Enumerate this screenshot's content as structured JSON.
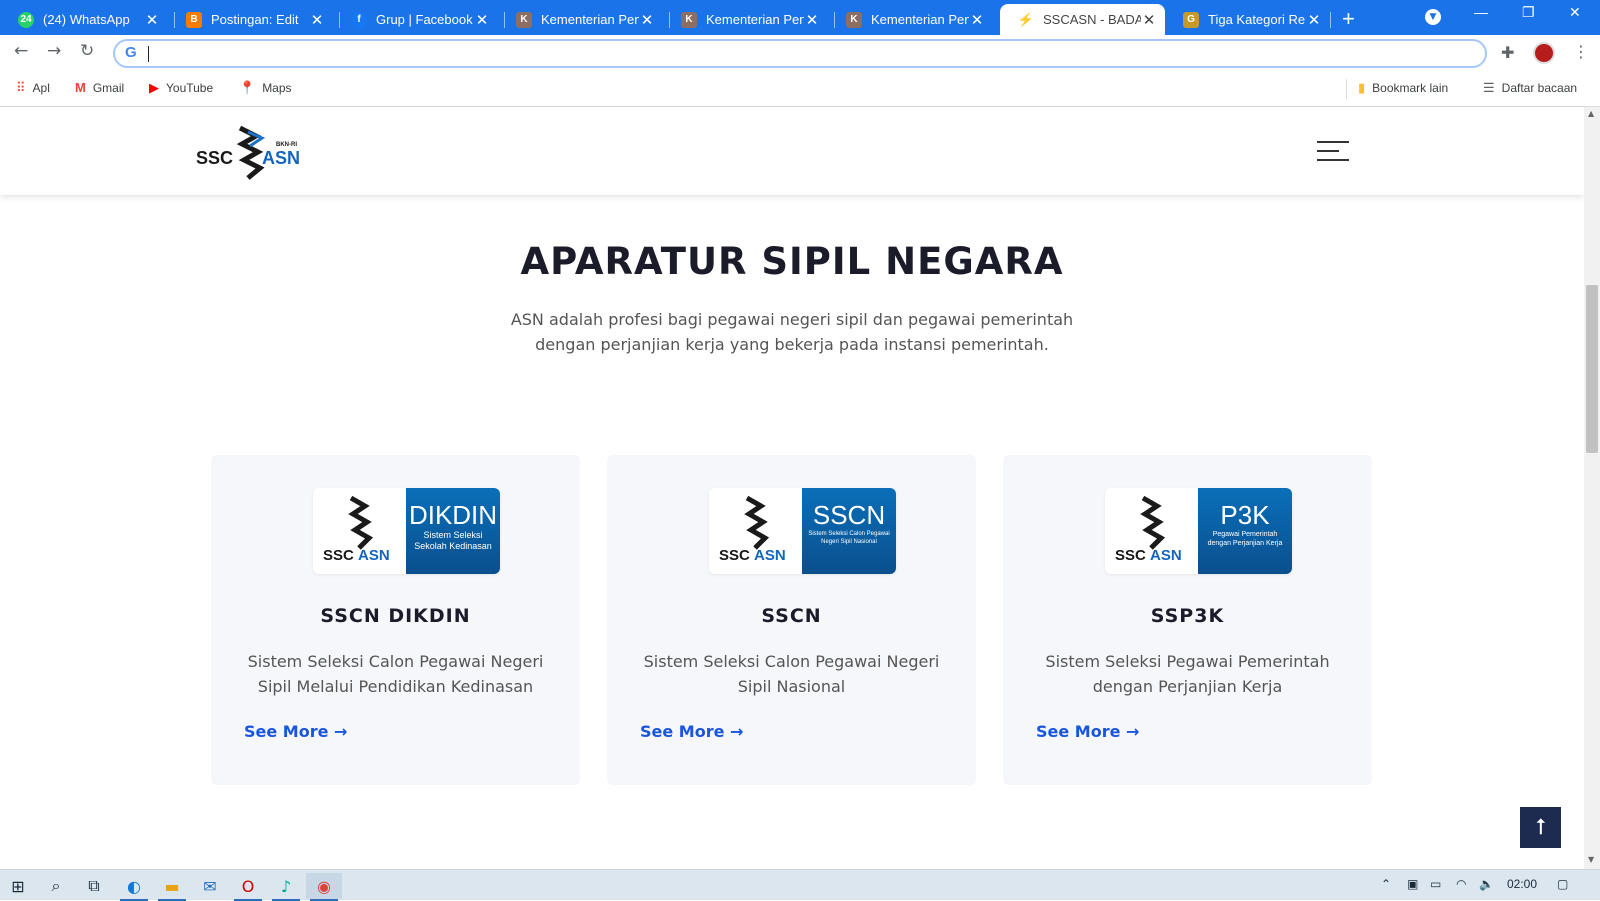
{
  "browser": {
    "tabs": [
      {
        "title": "(24) WhatsApp",
        "favicon_color": "#25d366",
        "favicon_char": "24"
      },
      {
        "title": "Postingan: Edit",
        "favicon_color": "#f57c00",
        "favicon_char": "B"
      },
      {
        "title": "Grup | Facebook",
        "favicon_color": "#1877f2",
        "favicon_char": "f"
      },
      {
        "title": "Kementerian Pend",
        "favicon_color": "#8d6e63",
        "favicon_char": "K"
      },
      {
        "title": "Kementerian Pend",
        "favicon_color": "#8d6e63",
        "favicon_char": "K"
      },
      {
        "title": "Kementerian Pend",
        "favicon_color": "#8d6e63",
        "favicon_char": "K"
      },
      {
        "title": "SSCASN - BADAN",
        "favicon_color": "#222222",
        "favicon_char": "S",
        "active": true
      },
      {
        "title": "Tiga Kategori Rek",
        "favicon_color": "#c49a2c",
        "favicon_char": "G"
      }
    ],
    "omnibox_value": "",
    "bookmarks": [
      {
        "label": "Apl",
        "icon": "apps-grid-icon"
      },
      {
        "label": "Gmail",
        "icon": "gmail-icon"
      },
      {
        "label": "YouTube",
        "icon": "youtube-icon"
      },
      {
        "label": "Maps",
        "icon": "maps-icon"
      }
    ],
    "bookmarks_right": [
      {
        "label": "Bookmark lain",
        "icon": "folder-icon"
      },
      {
        "label": "Daftar bacaan",
        "icon": "reading-list-icon"
      }
    ]
  },
  "site": {
    "logo_text_left": "SSC",
    "logo_text_right": "ASN",
    "logo_tag": "BKN-RI",
    "heading": "APARATUR SIPIL NEGARA",
    "subtitle": "ASN adalah profesi bagi pegawai negeri sipil dan pegawai pemerintah dengan perjanjian kerja yang bekerja pada instansi pemerintah.",
    "cards": [
      {
        "badge_big": "DIKDIN",
        "badge_small": "Sistem Seleksi Sekolah Kedinasan",
        "title": "SSCN DIKDIN",
        "desc": "Sistem Seleksi Calon Pegawai Negeri Sipil Melalui Pendidikan Kedinasan",
        "link": "See More →"
      },
      {
        "badge_big": "SSCN",
        "badge_small": "Sistem Seleksi Calon Pegawai Negeri Sipil Nasional",
        "title": "SSCN",
        "desc": "Sistem Seleksi Calon Pegawai Negeri Sipil Nasional",
        "link": "See More →"
      },
      {
        "badge_big": "P3K",
        "badge_small": "Pegawai Pemerintah dengan Perjanjian Kerja",
        "title": "SSP3K",
        "desc": "Sistem Seleksi Pegawai Pemerintah dengan Perjanjian Kerja",
        "link": "See More →"
      }
    ]
  },
  "taskbar": {
    "clock": "02:00"
  },
  "colors": {
    "tabstrip": "#1a73e8",
    "link": "#1a56db",
    "back_to_top": "#1c2b4f",
    "badge_blue": "#0a6fb8"
  }
}
